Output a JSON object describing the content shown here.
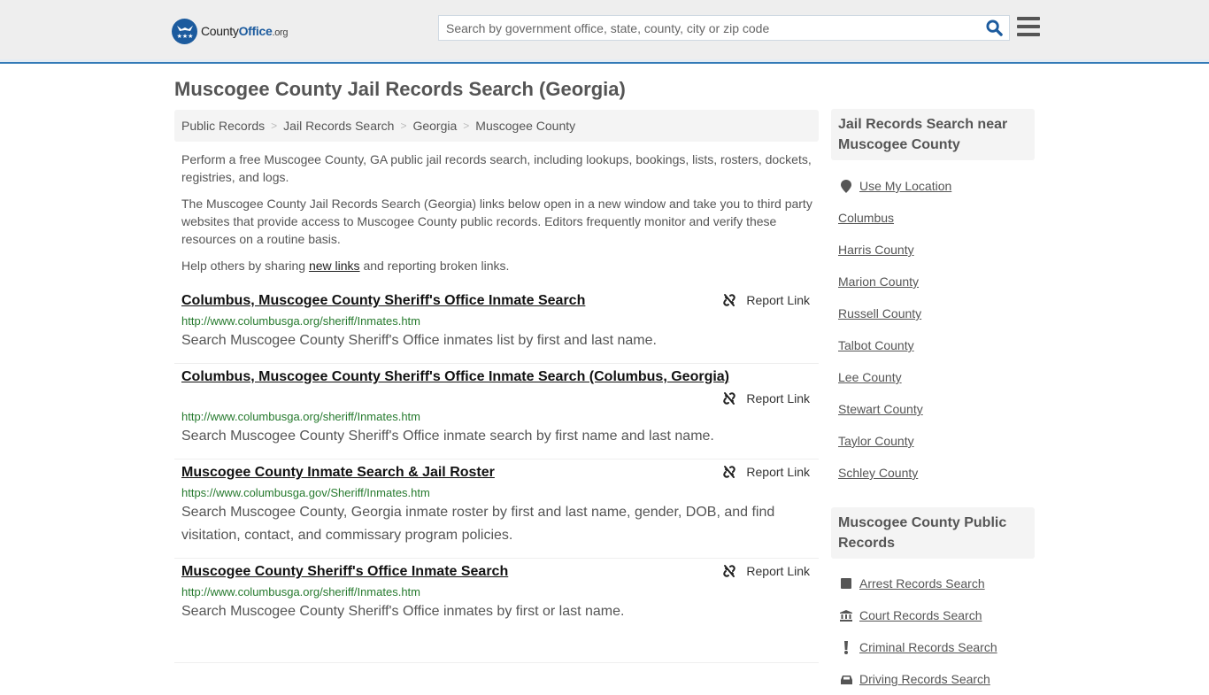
{
  "header": {
    "logo": {
      "county": "County",
      "office": "Office",
      "tld": ".org"
    },
    "search": {
      "placeholder": "Search by government office, state, county, city or zip code",
      "value": ""
    },
    "colors": {
      "accent": "#337ab7",
      "brand": "#1c5b9e",
      "header_bg": "#eeeeee"
    }
  },
  "page": {
    "title": "Muscogee County Jail Records Search (Georgia)",
    "breadcrumb": [
      "Public Records",
      "Jail Records Search",
      "Georgia",
      "Muscogee County"
    ],
    "intro": {
      "p1": "Perform a free Muscogee County, GA public jail records search, including lookups, bookings, lists, rosters, dockets, registries, and logs.",
      "p2": "The Muscogee County Jail Records Search (Georgia) links below open in a new window and take you to third party websites that provide access to Muscogee County public records. Editors frequently monitor and verify these resources on a routine basis.",
      "p3_before": "Help others by sharing ",
      "p3_link": "new links",
      "p3_after": " and reporting broken links."
    },
    "report_label": "Report Link",
    "results": [
      {
        "title": "Columbus, Muscogee County Sheriff's Office Inmate Search",
        "url": "http://www.columbusga.org/sheriff/Inmates.htm",
        "desc": "Search Muscogee County Sheriff's Office inmates list by first and last name."
      },
      {
        "title": "Columbus, Muscogee County Sheriff's Office Inmate Search (Columbus, Georgia)",
        "url": "http://www.columbusga.org/sheriff/Inmates.htm",
        "desc": "Search Muscogee County Sheriff's Office inmate search by first name and last name."
      },
      {
        "title": "Muscogee County Inmate Search & Jail Roster",
        "url": "https://www.columbusga.gov/Sheriff/Inmates.htm",
        "desc": "Search Muscogee County, Georgia inmate roster by first and last name, gender, DOB, and find visitation, contact, and commissary program policies."
      },
      {
        "title": "Muscogee County Sheriff's Office Inmate Search",
        "url": "http://www.columbusga.org/sheriff/Inmates.htm",
        "desc": "Search Muscogee County Sheriff's Office inmates by first or last name."
      }
    ]
  },
  "sidebar": {
    "nearby": {
      "heading": "Jail Records Search near Muscogee County",
      "use_location": "Use My Location",
      "items": [
        "Columbus",
        "Harris County",
        "Marion County",
        "Russell County",
        "Talbot County",
        "Lee County",
        "Stewart County",
        "Taylor County",
        "Schley County"
      ]
    },
    "public_records": {
      "heading": "Muscogee County Public Records",
      "items": [
        {
          "label": "Arrest Records Search",
          "icon": "square-icon"
        },
        {
          "label": "Court Records Search",
          "icon": "courthouse-icon"
        },
        {
          "label": "Criminal Records Search",
          "icon": "exclamation-icon"
        },
        {
          "label": "Driving Records Search",
          "icon": "car-icon"
        }
      ]
    }
  }
}
